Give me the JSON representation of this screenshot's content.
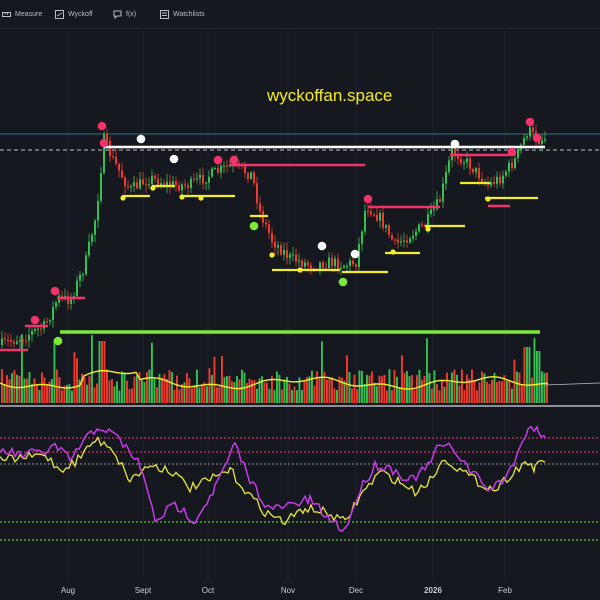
{
  "toolbar": {
    "items": [
      {
        "label": "Measure",
        "icon": "ruler-icon"
      },
      {
        "label": "Wyckoff",
        "icon": "wyckoff-icon"
      },
      {
        "label": "f(x)",
        "icon": "function-icon"
      },
      {
        "label": "Watchlists",
        "icon": "watchlist-icon"
      }
    ]
  },
  "watermark": "wyckoffan.space",
  "x_axis": {
    "months": [
      "Aug",
      "Sept",
      "Oct",
      "Nov",
      "Dec",
      "2026",
      "Feb"
    ]
  },
  "colors": {
    "background": "#16181f",
    "candle_up": "#33c152",
    "candle_down": "#f23b2f",
    "support_level": "#f3ec2e",
    "resistance_level": "#f2336a",
    "major_support": "#7be83a",
    "breakout_line": "#ffffff",
    "oscillator_a": "#c53ce6",
    "oscillator_b": "#e6e642",
    "volume_ma": "#f3ec2e"
  }
}
